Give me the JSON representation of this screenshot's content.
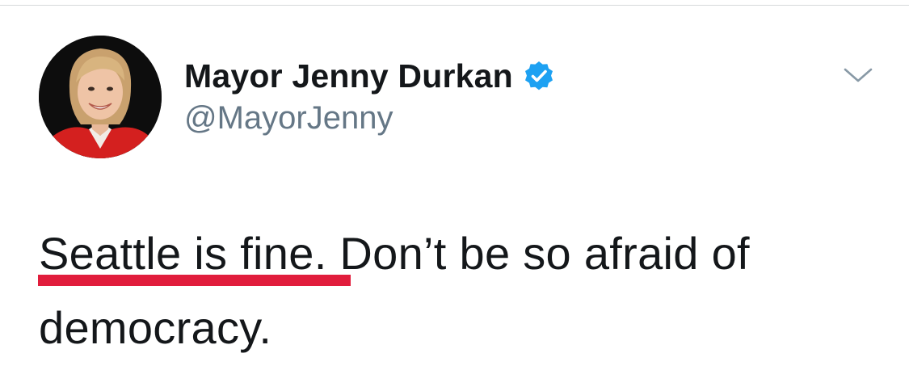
{
  "tweet": {
    "author": {
      "display_name": "Mayor Jenny Durkan",
      "handle": "@MayorJenny",
      "verified": true,
      "avatar_icon": "profile-photo"
    },
    "text_highlighted": "Seattle is fine.",
    "text_rest": "Don’t be so afraid of democracy.",
    "menu_icon": "chevron-down-icon"
  },
  "colors": {
    "text": "#14171a",
    "handle": "#657786",
    "verified_badge": "#1da1f2",
    "highlight_underline": "#e11d3c",
    "divider": "#d6d9db"
  }
}
